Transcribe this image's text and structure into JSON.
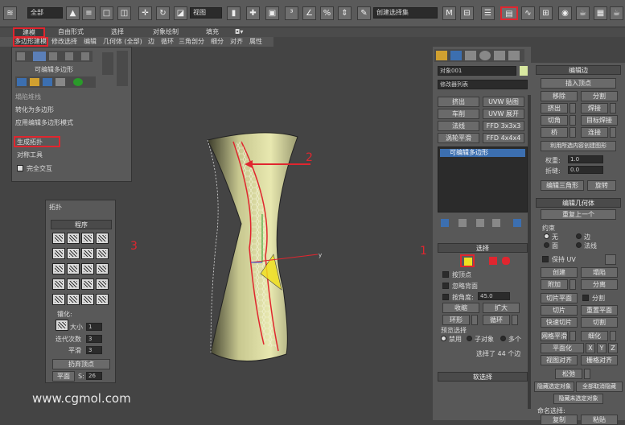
{
  "toolbar": {
    "filter_select": "全部",
    "view_select": "视图",
    "selection_set": "创建选择集"
  },
  "ribbon": {
    "tabs": [
      "建模",
      "自由形式",
      "选择",
      "对象绘制",
      "填充"
    ],
    "sub_tabs": [
      "多边形建模",
      "修改选择",
      "编辑",
      "几何体 (全部)",
      "边",
      "循环",
      "三角剖分",
      "细分",
      "对齐",
      "属性"
    ]
  },
  "modeling_popup": {
    "editable_poly": "可编辑多边形",
    "collapse_stack": "塌陷堆栈",
    "convert_poly": "转化为多边形",
    "apply_poly_mode": "应用编辑多边形模式",
    "generate_topology": "生成拓扑",
    "symmetry_tools": "对称工具",
    "full_interactive": "完全交互"
  },
  "topology_panel": {
    "title": "拓扑",
    "header": "程序",
    "tessellation_label": "镶化:",
    "size_label": "大小",
    "size_value": "1",
    "iterations_label": "迭代次数",
    "iterations_value": "3",
    "smooth_label": "平滑",
    "smooth_value": "3",
    "flip_vertices": "扔弃顶点",
    "flat_label": "平面",
    "s_label": "S:",
    "s_value": "26"
  },
  "annotations": [
    "1",
    "2",
    "3"
  ],
  "watermark": "www.cgmol.com",
  "command_panel": {
    "object_name": "对象001",
    "modifier_list": "修改器列表",
    "modifier_buttons": [
      "挤出",
      "UVW 贴图",
      "车削",
      "UVW 展开",
      "法线",
      "FFD 3x3x3",
      "涡轮平滑",
      "FFD 4x4x4"
    ],
    "stack_item": "可编辑多边形",
    "selection_header": "选择",
    "by_vertex": "按顶点",
    "ignore_backfacing": "忽略背面",
    "by_angle": "按角度:",
    "angle_value": "45.0",
    "shrink": "收缩",
    "grow": "扩大",
    "ring": "环形",
    "loop": "循环",
    "preview_selection": "预览选择",
    "disabled": "禁用",
    "subobject": "子对象",
    "multi": "多个",
    "selected_count": "选择了 44 个边",
    "soft_selection": "软选择"
  },
  "edit_edges": {
    "header": "编辑边",
    "insert_vertex": "插入顶点",
    "remove": "移除",
    "split": "分割",
    "extrude": "挤出",
    "weld": "焊接",
    "chamfer": "切角",
    "target_weld": "目标焊接",
    "bridge": "桥",
    "connect": "连接",
    "create_shape": "利用所选内容创建图形",
    "weight_label": "权重:",
    "weight_value": "1.0",
    "crease_label": "折缝:",
    "crease_value": "0.0",
    "edit_tri": "编辑三角形",
    "turn": "旋转"
  },
  "edit_geometry": {
    "header": "编辑几何体",
    "repeat_last": "重复上一个",
    "constraints": "约束",
    "none": "无",
    "edge": "边",
    "face": "面",
    "normal": "法线",
    "preserve_uv": "保持 UV",
    "create": "创建",
    "collapse": "塌陷",
    "attach": "附加",
    "detach": "分离",
    "slice_plane": "切片平面",
    "split": "分割",
    "slice": "切片",
    "reset_plane": "重置平面",
    "quickslice": "快速切片",
    "cut": "切割",
    "meshsmooth": "网格平滑",
    "tessellate": "细化",
    "make_planar": "平面化",
    "x": "X",
    "y": "Y",
    "z": "Z",
    "view_align": "视图对齐",
    "grid_align": "栅格对齐",
    "relax": "松弛",
    "hide_selected": "隐藏选定对象",
    "unhide_all": "全部取消隐藏",
    "hide_unselected": "隐藏未选定对象",
    "named_selections": "命名选择:",
    "copy": "复制",
    "paste": "粘贴"
  }
}
